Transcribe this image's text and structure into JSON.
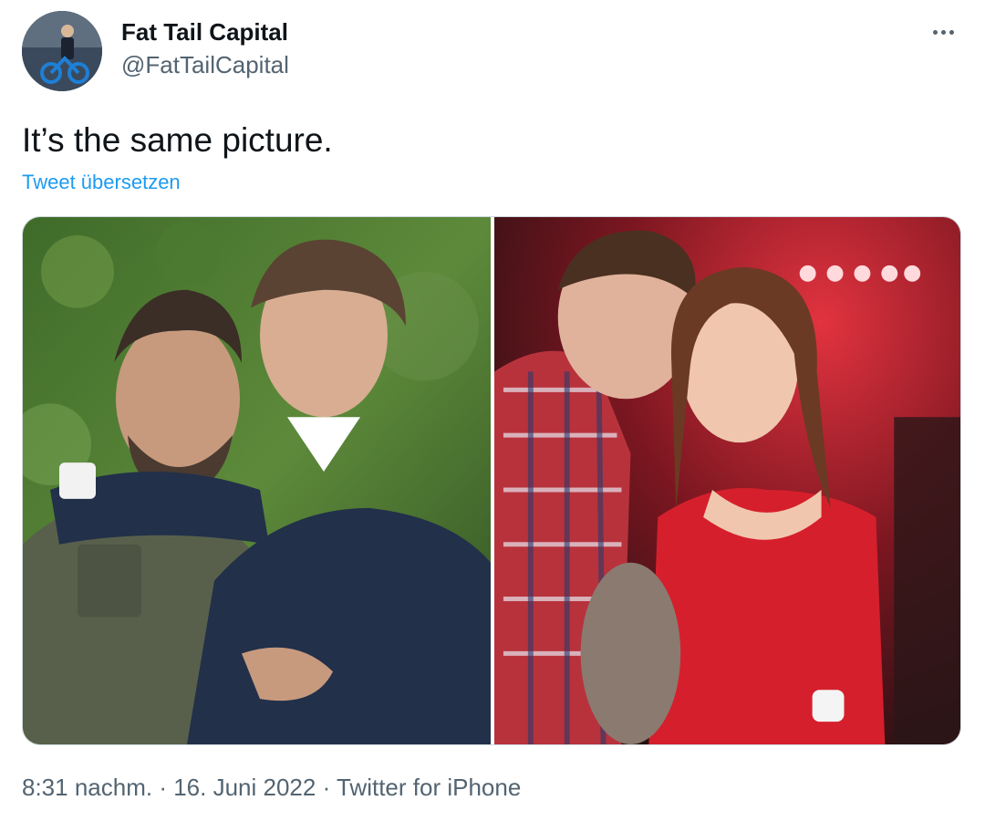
{
  "author": {
    "name": "Fat Tail Capital",
    "handle": "@FatTailCapital",
    "avatar_icon": "avatar-photo-man-on-bicycle"
  },
  "tweet": {
    "text": "It’s the same picture.",
    "translate_label": "Tweet übersetzen",
    "more_icon": "more-dots-icon"
  },
  "media": {
    "count": 2,
    "photos": [
      {
        "kind": "photo",
        "subject": "two men embracing, one whispering"
      },
      {
        "kind": "photo",
        "subject": "young man whispering to young woman at party"
      }
    ]
  },
  "meta": {
    "time": "8:31 nachm.",
    "separator": " · ",
    "date": "16. Juni 2022",
    "source": "Twitter for iPhone"
  },
  "colors": {
    "accent": "#1d9bf0",
    "text_primary": "#0f1419",
    "text_secondary": "#536471",
    "border": "#cfd9de"
  }
}
